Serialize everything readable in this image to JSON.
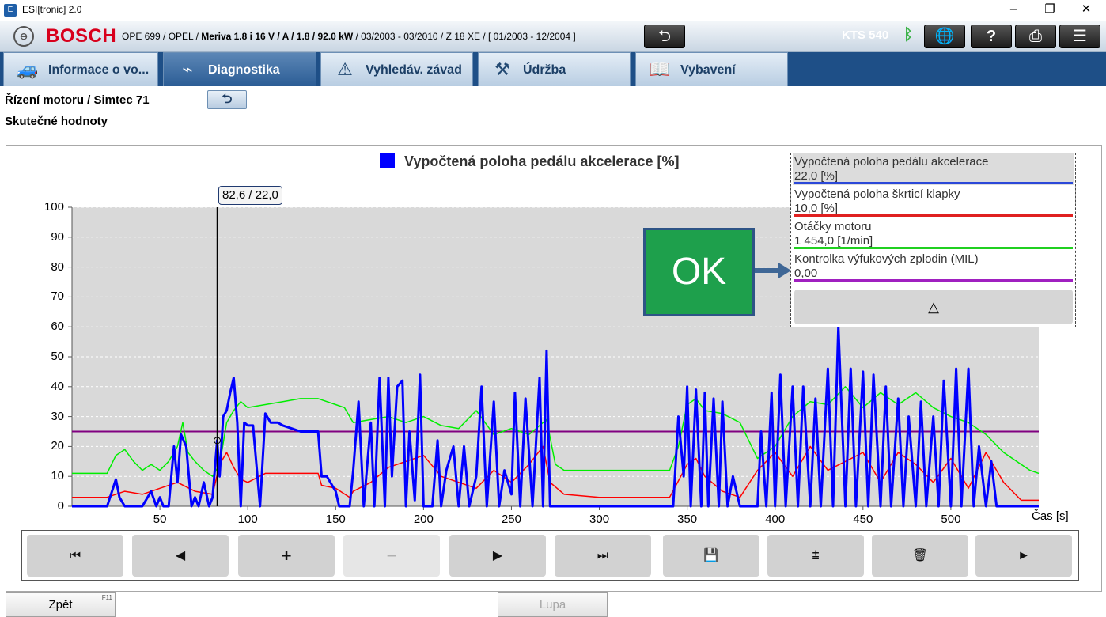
{
  "window": {
    "title": "ESI[tronic] 2.0",
    "minimize": "–",
    "restore": "❐",
    "close": "✕"
  },
  "header": {
    "brand": "BOSCH",
    "vehicle_prefix": "OPE 699 / OPEL / ",
    "vehicle_model": "Meriva 1.8 i 16 V / A / 1.8 / 92.0 kW",
    "vehicle_suffix": " / 03/2003 - 03/2010 / Z 18 XE / [ 01/2003 - 12/2004 ]",
    "back_icon": "back-arrow-icon",
    "device": "KTS 540",
    "bluetooth_icon": "bluetooth-icon",
    "buttons": [
      "network-off-icon",
      "help-icon",
      "print-icon",
      "menu-icon"
    ]
  },
  "tabs": [
    {
      "label": "Informace o vo...",
      "icon": "vehicle-info-icon",
      "active": false
    },
    {
      "label": "Diagnostika",
      "icon": "diagnostics-plug-icon",
      "active": true
    },
    {
      "label": "Vyhledáv. závad",
      "icon": "troubleshoot-icon",
      "active": false
    },
    {
      "label": "Údržba",
      "icon": "maintenance-icon",
      "active": false
    },
    {
      "label": "Vybavení",
      "icon": "equipment-book-icon",
      "active": false
    }
  ],
  "page": {
    "breadcrumb": "Řízení motoru / Simtec 71",
    "subtitle": "Skutečné hodnoty"
  },
  "chart_data": {
    "type": "line",
    "title": "Vypočtená poloha pedálu akcelerace [%]",
    "xlabel": "Čas [s]",
    "ylabel": "",
    "xlim": [
      0,
      550
    ],
    "ylim": [
      0,
      100
    ],
    "x_ticks": [
      50,
      100,
      150,
      200,
      250,
      300,
      350,
      400,
      450,
      500
    ],
    "y_ticks": [
      0,
      10,
      20,
      30,
      40,
      50,
      60,
      70,
      80,
      90,
      100
    ],
    "grid": true,
    "cursor": {
      "x": 82.6,
      "y": 22.0,
      "label": "82,6 / 22,0"
    },
    "series": [
      {
        "name": "Vypočtená poloha pedálu akcelerace",
        "color": "#0000ff",
        "x": [
          0,
          20,
          25,
          27,
          30,
          33,
          40,
          45,
          48,
          50,
          52,
          55,
          58,
          60,
          62,
          65,
          68,
          70,
          72,
          75,
          78,
          80,
          82.6,
          84,
          86,
          88,
          90,
          92,
          94,
          96,
          98,
          100,
          103,
          107,
          110,
          113,
          117,
          120,
          125,
          130,
          135,
          140,
          142,
          145,
          148,
          150,
          152,
          155,
          158,
          160,
          163,
          166,
          170,
          172,
          175,
          178,
          180,
          182,
          185,
          188,
          190,
          192,
          195,
          198,
          200,
          205,
          208,
          210,
          213,
          217,
          220,
          223,
          226,
          230,
          233,
          236,
          240,
          243,
          246,
          250,
          252,
          255,
          258,
          262,
          266,
          268,
          270,
          272,
          275,
          280,
          300,
          320,
          340,
          342,
          345,
          348,
          350,
          352,
          355,
          358,
          360,
          362,
          365,
          368,
          370,
          373,
          376,
          380,
          385,
          390,
          392,
          395,
          398,
          400,
          403,
          406,
          410,
          413,
          416,
          420,
          423,
          426,
          430,
          433,
          436,
          440,
          443,
          446,
          450,
          453,
          456,
          460,
          463,
          466,
          470,
          473,
          476,
          480,
          483,
          486,
          490,
          493,
          496,
          500,
          503,
          506,
          510,
          513,
          516,
          520,
          523,
          526,
          530,
          535,
          540,
          545,
          550
        ],
        "y": [
          0,
          0,
          9,
          3,
          0,
          0,
          0,
          5,
          0,
          3,
          0,
          0,
          20,
          8,
          24,
          20,
          0,
          3,
          0,
          8,
          0,
          3,
          22,
          10,
          30,
          32,
          38,
          43,
          28,
          0,
          28,
          27,
          27,
          0,
          31,
          28,
          28,
          27,
          26,
          25,
          25,
          25,
          10,
          10,
          7,
          5,
          0,
          0,
          0,
          12,
          35,
          0,
          28,
          0,
          43,
          0,
          43,
          10,
          40,
          42,
          0,
          25,
          2,
          44,
          0,
          0,
          22,
          0,
          12,
          20,
          0,
          20,
          0,
          10,
          40,
          0,
          35,
          0,
          12,
          4,
          38,
          0,
          36,
          0,
          43,
          0,
          52,
          0,
          0,
          0,
          0,
          0,
          0,
          0,
          30,
          10,
          40,
          0,
          39,
          0,
          38,
          0,
          36,
          0,
          35,
          0,
          10,
          0,
          0,
          0,
          25,
          0,
          38,
          0,
          44,
          0,
          40,
          0,
          40,
          0,
          36,
          0,
          46,
          0,
          60,
          0,
          46,
          0,
          45,
          0,
          44,
          0,
          40,
          0,
          36,
          0,
          30,
          0,
          35,
          0,
          30,
          0,
          42,
          0,
          46,
          0,
          46,
          0,
          20,
          0,
          15,
          0,
          0,
          0,
          0,
          0,
          0
        ]
      },
      {
        "name": "Vypočtená poloha škrticí klapky",
        "color": "#ff0000",
        "x": [
          0,
          20,
          30,
          40,
          50,
          60,
          70,
          80,
          84,
          88,
          92,
          96,
          100,
          110,
          130,
          140,
          142,
          150,
          158,
          160,
          170,
          180,
          190,
          200,
          210,
          230,
          240,
          250,
          260,
          268,
          272,
          280,
          300,
          320,
          340,
          350,
          355,
          360,
          370,
          380,
          390,
          400,
          410,
          420,
          430,
          440,
          450,
          460,
          470,
          480,
          490,
          500,
          510,
          520,
          530,
          540,
          550
        ],
        "y": [
          3,
          3,
          5,
          4,
          6,
          8,
          5,
          4,
          14,
          18,
          13,
          9,
          8,
          11,
          11,
          11,
          7,
          6,
          3,
          5,
          8,
          13,
          15,
          17,
          10,
          6,
          12,
          8,
          14,
          20,
          8,
          4,
          3,
          3,
          3,
          14,
          16,
          10,
          5,
          3,
          12,
          18,
          10,
          20,
          12,
          15,
          18,
          8,
          18,
          14,
          8,
          16,
          6,
          18,
          8,
          2,
          2
        ]
      },
      {
        "name": "Otáčky motoru",
        "color": "#00ee00",
        "x": [
          0,
          10,
          20,
          25,
          30,
          35,
          40,
          45,
          50,
          55,
          60,
          63,
          66,
          70,
          75,
          80,
          84,
          88,
          92,
          96,
          100,
          110,
          120,
          130,
          140,
          150,
          155,
          158,
          160,
          170,
          180,
          190,
          200,
          210,
          220,
          230,
          240,
          250,
          260,
          270,
          275,
          280,
          300,
          320,
          340,
          345,
          350,
          355,
          360,
          370,
          380,
          390,
          400,
          410,
          420,
          430,
          440,
          450,
          460,
          470,
          480,
          490,
          500,
          510,
          520,
          530,
          540,
          545,
          550
        ],
        "y": [
          11,
          11,
          11,
          17,
          19,
          15,
          12,
          14,
          12,
          15,
          20,
          28,
          18,
          15,
          12,
          10,
          14,
          28,
          32,
          35,
          33,
          34,
          35,
          36,
          36,
          34,
          33,
          30,
          28,
          29,
          30,
          28,
          30,
          27,
          26,
          32,
          24,
          26,
          24,
          29,
          14,
          12,
          12,
          12,
          12,
          20,
          34,
          36,
          32,
          31,
          28,
          16,
          20,
          30,
          35,
          34,
          40,
          33,
          38,
          34,
          38,
          33,
          30,
          28,
          24,
          18,
          14,
          12,
          11
        ]
      },
      {
        "name": "Kontrolka výfukových zplodin (MIL)",
        "color": "#800080",
        "x": [
          0,
          550
        ],
        "y": [
          25,
          25
        ]
      }
    ]
  },
  "legend": [
    {
      "name": "Vypočtená poloha pedálu akcelerace",
      "value": "22,0 [%]",
      "color": "#2b48d8"
    },
    {
      "name": "Vypočtená poloha škrticí klapky",
      "value": "10,0 [%]",
      "color": "#e02020"
    },
    {
      "name": "Otáčky motoru",
      "value": "1 454,0 [1/min]",
      "color": "#20d020"
    },
    {
      "name": "Kontrolka výfukových zplodin (MIL)",
      "value": "0,00",
      "color": "#a020c0"
    }
  ],
  "legend_collapse": "△",
  "overlay": {
    "ok": "OK"
  },
  "toolbar": [
    {
      "name": "first-icon",
      "glyph": "⏮",
      "disabled": false
    },
    {
      "name": "prev-icon",
      "glyph": "◀",
      "disabled": false
    },
    {
      "name": "zoom-in-icon",
      "glyph": "+",
      "disabled": false
    },
    {
      "name": "zoom-out-icon",
      "glyph": "−",
      "disabled": true
    },
    {
      "name": "next-icon",
      "glyph": "▶",
      "disabled": false
    },
    {
      "name": "last-icon",
      "glyph": "⏭",
      "disabled": false
    },
    {
      "name": "save-icon",
      "glyph": "💾",
      "disabled": false
    },
    {
      "name": "chart-settings-icon",
      "glyph": "⩲",
      "disabled": false
    },
    {
      "name": "delete-icon",
      "glyph": "🗑",
      "disabled": false
    },
    {
      "name": "play-icon",
      "glyph": "►",
      "disabled": false
    }
  ],
  "footer": {
    "back_label": "Zpět",
    "back_key": "F11",
    "zoom_label": "Lupa"
  }
}
